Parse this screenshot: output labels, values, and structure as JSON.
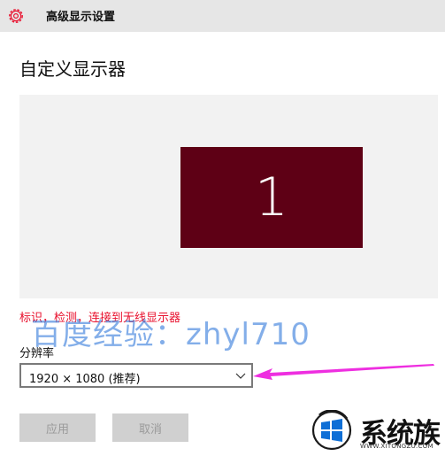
{
  "header": {
    "title": "高级显示设置",
    "icon": "gear-icon",
    "accent_color": "#e8102d"
  },
  "page": {
    "title": "自定义显示器"
  },
  "preview": {
    "monitor_number": "1",
    "monitor_color": "#5e0015"
  },
  "links": {
    "text": "标识，检测，连接到无线显示器"
  },
  "watermark": {
    "text": "百度经验：zhyl710"
  },
  "resolution": {
    "label": "分辨率",
    "selected": "1920 × 1080 (推荐)"
  },
  "buttons": {
    "apply": "应用",
    "cancel": "取消"
  },
  "annotation": {
    "arrow_color": "#ee2ee0"
  },
  "logo": {
    "brand": "系统族",
    "url": "WWW.XITONGZU.COM"
  }
}
